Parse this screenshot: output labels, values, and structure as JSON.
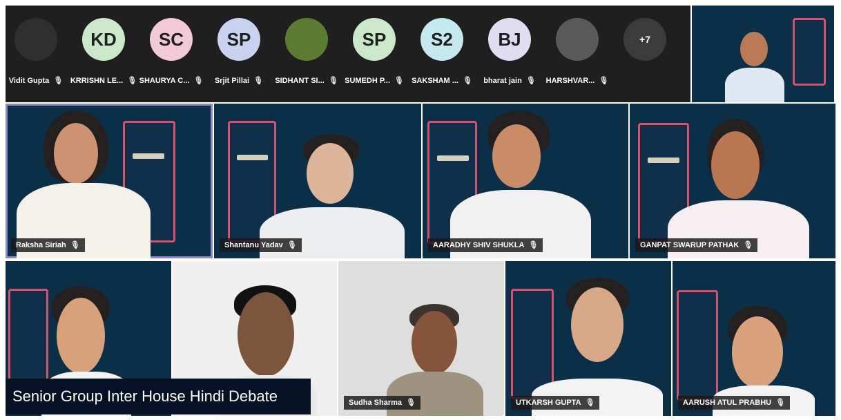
{
  "participants": [
    {
      "name": "Vidit Gupta",
      "initials": "",
      "color": "#2f2f2f"
    },
    {
      "name": "KRRISHN LE...",
      "initials": "KD",
      "color": "#cbe8cb"
    },
    {
      "name": "SHAURYA C...",
      "initials": "SC",
      "color": "#f2c9d6"
    },
    {
      "name": "Srjit Pillai",
      "initials": "SP",
      "color": "#c9d3ef"
    },
    {
      "name": "SIDHANT SI...",
      "initials": "",
      "color": "#5c7c34"
    },
    {
      "name": "SUMEDH P...",
      "initials": "SP",
      "color": "#cbe8cb"
    },
    {
      "name": "SAKSHAM ...",
      "initials": "S2",
      "color": "#c6e9f0"
    },
    {
      "name": "bharat jain",
      "initials": "BJ",
      "color": "#e0ddf2"
    },
    {
      "name": "HARSHVAR...",
      "initials": "",
      "color": "#595959"
    }
  ],
  "more_count": "+7",
  "tiles": [
    {
      "name": "Raksha Siriah",
      "active": true
    },
    {
      "name": "Shantanu Yadav",
      "active": false
    },
    {
      "name": "AARADHY SHIV SHUKLA",
      "active": false
    },
    {
      "name": "GANPAT SWARUP PATHAK",
      "active": false
    },
    {
      "name": "",
      "active": false
    },
    {
      "name": "",
      "active": false
    },
    {
      "name": "Sudha Sharma",
      "active": false
    },
    {
      "name": "UTKARSH GUPTA",
      "active": false
    },
    {
      "name": "AARUSH ATUL PRABHU",
      "active": false
    }
  ],
  "banner": "Senior Group Inter House Hindi Debate",
  "colors": {
    "tile_bg": "#0c2f48",
    "active_outline": "#8d86c9",
    "strip_bg": "#1f1f1f"
  }
}
